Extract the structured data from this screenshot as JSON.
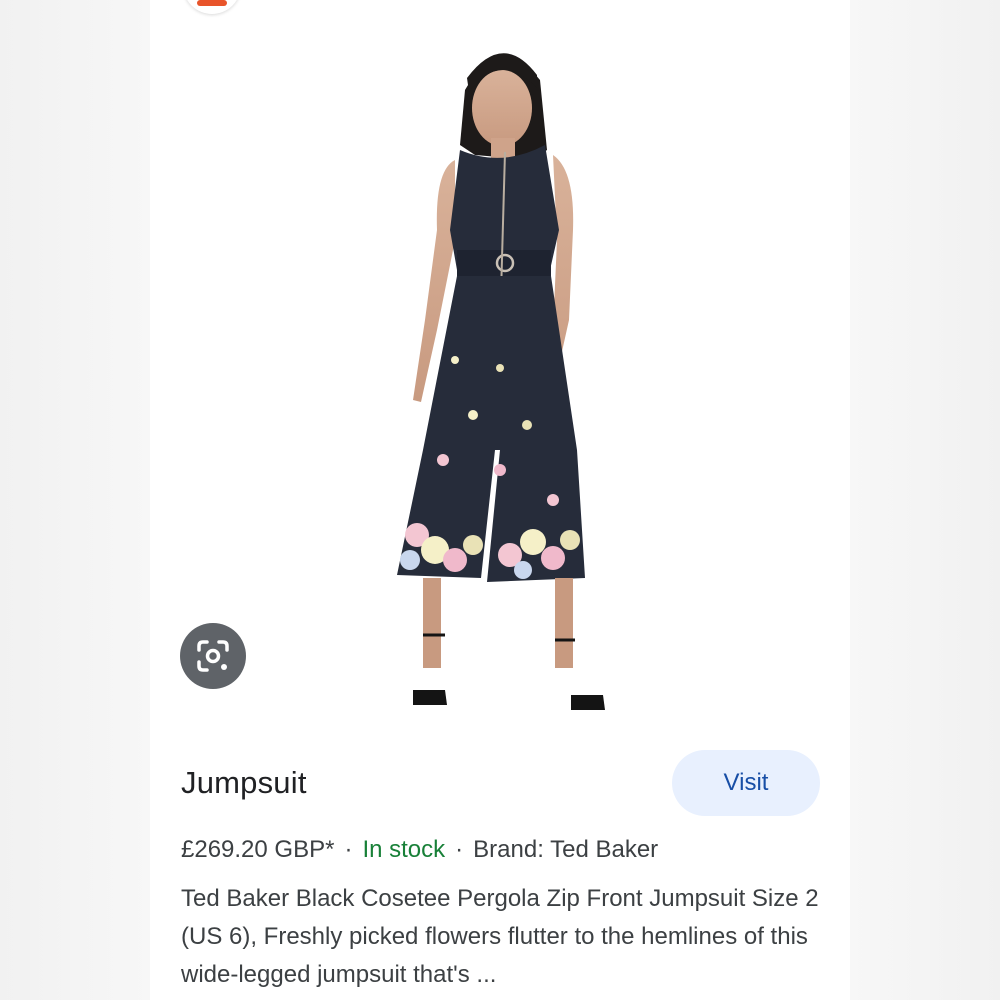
{
  "product": {
    "title": "Jumpsuit",
    "visit_label": "Visit",
    "price": "£269.20 GBP*",
    "separator": "·",
    "availability": "In stock",
    "brand": "Brand: Ted Baker",
    "description": "Ted Baker Black Cosetee Pergola Zip Front Jumpsuit Size 2 (US 6), Freshly picked flowers flutter to the hemlines of this wide-legged jumpsuit that's ..."
  },
  "image": {
    "alt": "Model wearing navy sleeveless zip-front jumpsuit with floral hem and black heels"
  },
  "icons": {
    "lens": "google-lens-icon"
  },
  "colors": {
    "accent_link": "#174ea6",
    "visit_bg": "#e8f0fe",
    "in_stock": "#188038",
    "lens_bg": "#5f6368",
    "garment": "#262c3a"
  }
}
